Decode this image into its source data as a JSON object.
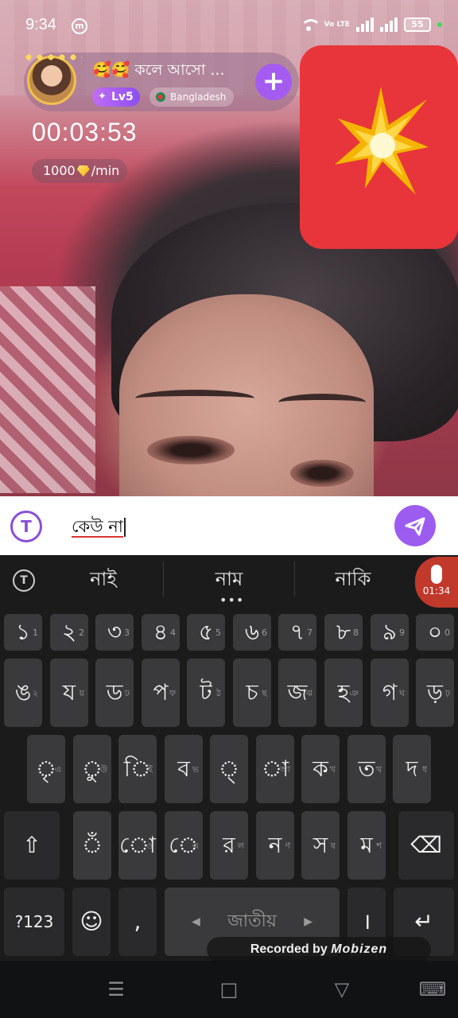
{
  "status_bar": {
    "time": "9:34",
    "app_icon": "m",
    "volte": "Vo LTE",
    "battery": "55"
  },
  "host": {
    "name": "🥰🥰 কলে আসো ...",
    "level": "Lv5",
    "country": "Bangladesh",
    "follow_label": "+"
  },
  "call": {
    "timer": "00:03:53",
    "rate_amount": "1000",
    "rate_unit": "/min"
  },
  "input": {
    "translate_label": "T",
    "value": "কেউ না"
  },
  "keyboard": {
    "suggestions": [
      "নাই",
      "নাম",
      "নাকি"
    ],
    "recording_time": "01:34",
    "row1": [
      {
        "label": "১",
        "hint": "1"
      },
      {
        "label": "২",
        "hint": "2"
      },
      {
        "label": "৩",
        "hint": "3"
      },
      {
        "label": "৪",
        "hint": "4"
      },
      {
        "label": "৫",
        "hint": "5"
      },
      {
        "label": "৬",
        "hint": "6"
      },
      {
        "label": "৭",
        "hint": "7"
      },
      {
        "label": "৮",
        "hint": "8"
      },
      {
        "label": "৯",
        "hint": "9"
      },
      {
        "label": "০",
        "hint": "0"
      }
    ],
    "row2": [
      {
        "label": "ঙ",
        "hint": "২"
      },
      {
        "label": "য",
        "hint": "য়"
      },
      {
        "label": "ড",
        "hint": "ঢ"
      },
      {
        "label": "প",
        "hint": "ফ"
      },
      {
        "label": "ট",
        "hint": "ঠ"
      },
      {
        "label": "চ",
        "hint": "ছ"
      },
      {
        "label": "জ",
        "hint": "ঝ"
      },
      {
        "label": "হ",
        "hint": "ঞ"
      },
      {
        "label": "গ",
        "hint": "ঘ"
      },
      {
        "label": "ড়",
        "hint": "ঢ়"
      }
    ],
    "row3": [
      {
        "label": "ৃ",
        "hint": "এ"
      },
      {
        "label": "ু",
        "hint": "উ"
      },
      {
        "label": "ি",
        "hint": "ই"
      },
      {
        "label": "ব",
        "hint": "ভ"
      },
      {
        "label": "্",
        "hint": ""
      },
      {
        "label": "া",
        "hint": "আ"
      },
      {
        "label": "ক",
        "hint": "খ"
      },
      {
        "label": "ত",
        "hint": "থ"
      },
      {
        "label": "দ",
        "hint": "ধ"
      }
    ],
    "row4": [
      {
        "label": "ঁ",
        "hint": ""
      },
      {
        "label": "ো",
        "hint": "ও"
      },
      {
        "label": "ে",
        "hint": "এ"
      },
      {
        "label": "র",
        "hint": "ল"
      },
      {
        "label": "ন",
        "hint": "ণ"
      },
      {
        "label": "স",
        "hint": "ষ"
      },
      {
        "label": "ম",
        "hint": "শ"
      }
    ],
    "shift_label": "⇧",
    "backspace_label": "⌫",
    "symbols_label": "?123",
    "emoji_label": "☺",
    "comma_label": ",",
    "space_label": "জাতীয়",
    "danda_label": "।",
    "enter_label": "↵",
    "space_left_arrow": "◀",
    "space_right_arrow": "▶"
  },
  "overlay": {
    "recorded_by": "Recorded by",
    "recorder_brand": "Mobizen"
  },
  "nav": {
    "menu": "☰",
    "home": "□",
    "back": "▽",
    "keyboard_switch": "⌨"
  },
  "colors": {
    "accent": "#9d5cf0",
    "preview_bg": "#e8353b",
    "keyboard_bg": "#1b1b1c",
    "key_bg": "#3a3a3c"
  }
}
